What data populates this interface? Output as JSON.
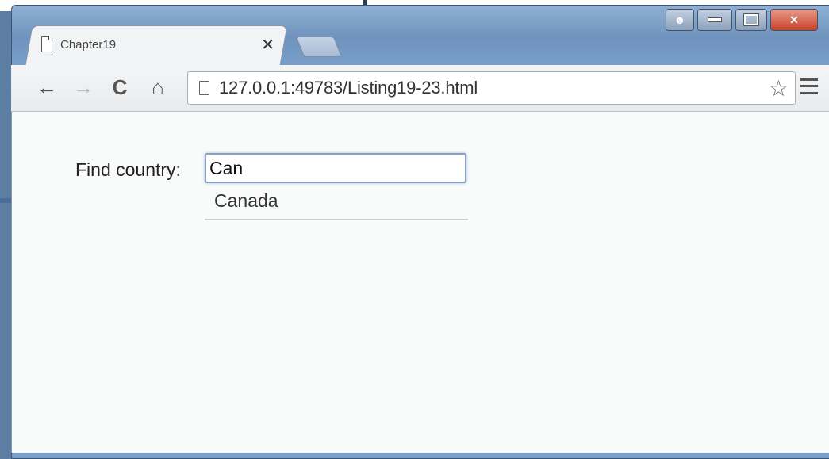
{
  "browser": {
    "tab": {
      "title": "Chapter19"
    },
    "address_bar": {
      "url": "127.0.0.1:49783/Listing19-23.html"
    }
  },
  "page": {
    "label": "Find country:",
    "search_value": "Can",
    "suggestions": [
      "Canada"
    ]
  },
  "colors": {
    "input_border": "#8aa1c2",
    "close_button": "#c6422c",
    "window_frame": "#6f93bd"
  }
}
